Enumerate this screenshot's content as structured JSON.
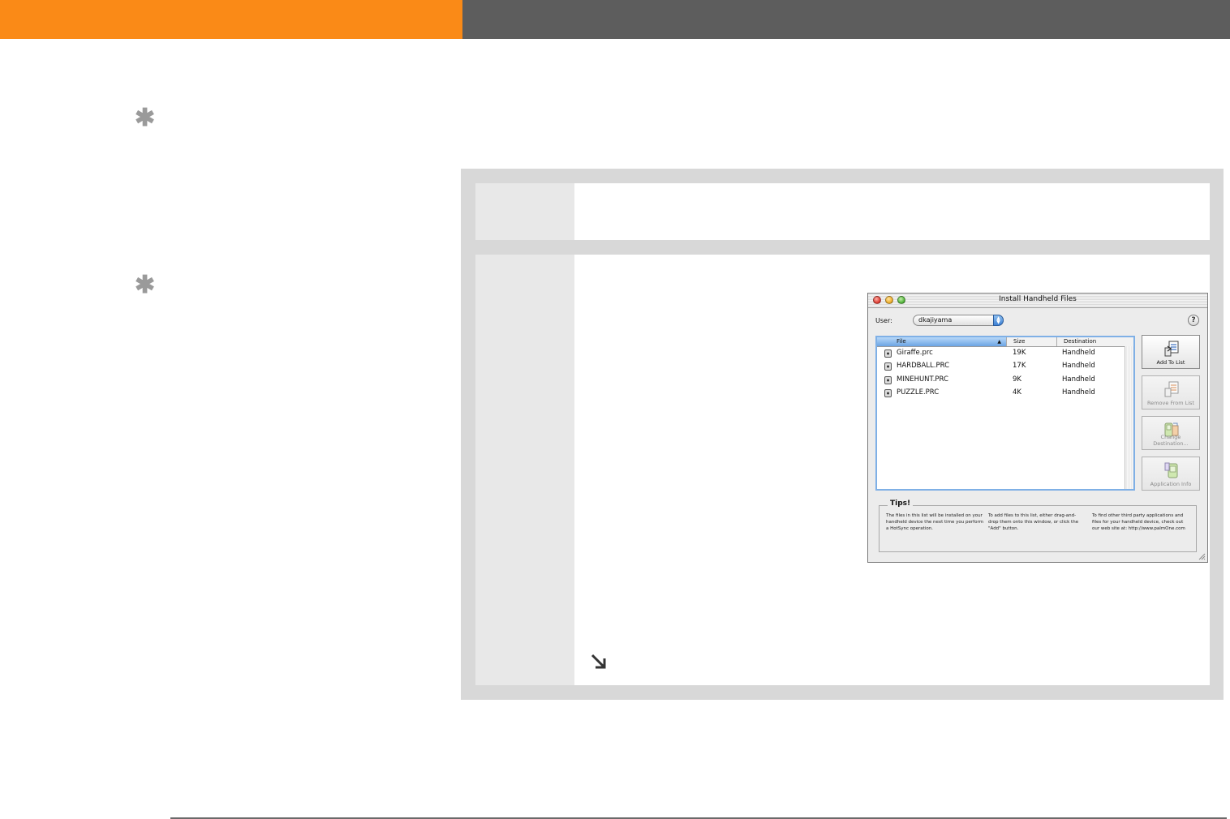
{
  "window": {
    "title": "Install Handheld Files",
    "user_label": "User:",
    "user_value": "dkajiyama",
    "help_glyph": "?",
    "columns": {
      "file": "File",
      "size": "Size",
      "destination": "Destination"
    },
    "files": [
      {
        "name": "Giraffe.prc",
        "size": "19K",
        "destination": "Handheld"
      },
      {
        "name": "HARDBALL.PRC",
        "size": "17K",
        "destination": "Handheld"
      },
      {
        "name": "MINEHUNT.PRC",
        "size": "9K",
        "destination": "Handheld"
      },
      {
        "name": "PUZZLE.PRC",
        "size": "4K",
        "destination": "Handheld"
      }
    ],
    "buttons": {
      "add": "Add To List",
      "remove": "Remove From List",
      "change": "Change Destination...",
      "info": "Application Info"
    },
    "tips": {
      "title": "Tips!",
      "col1": "The files in this list will be installed on your handheld device the next time you perform a HotSync operation.",
      "col2": "To add files to this list, either drag-and-drop them onto this window, or click the \"Add\" button.",
      "col3": "To find other third party applications and files for your handheld device, check out our web site at: http://www.palmOne.com"
    }
  },
  "icons": {
    "tip": "asterisk-icon",
    "continue": "arrow-down-right-icon"
  },
  "colors": {
    "header_orange": "#fa8a17",
    "header_gray": "#5d5d5d",
    "selection_blue": "#7fb0e6"
  }
}
